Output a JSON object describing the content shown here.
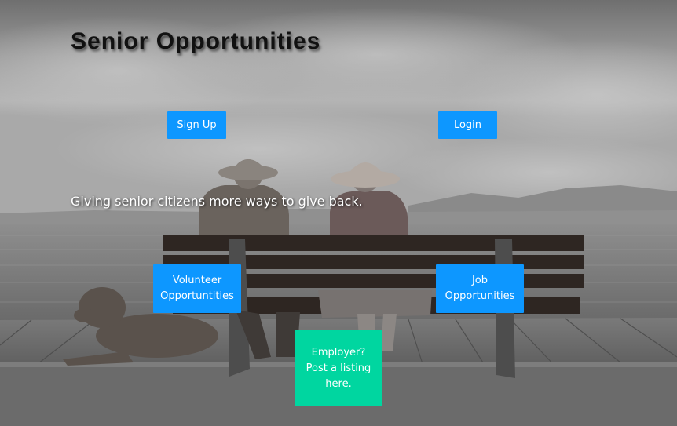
{
  "header": {
    "title": "Senior Opportunities"
  },
  "hero": {
    "tagline": "Giving senior citizens more ways to give back."
  },
  "auth": {
    "signup_label": "Sign Up",
    "login_label": "Login"
  },
  "actions": {
    "volunteer_label": "Volunteer Opportuntities",
    "job_label": "Job Opportunities",
    "employer_label": "Employer? Post a listing here."
  },
  "colors": {
    "primary_button": "#0d97ff",
    "employer_button": "#00d6a0",
    "button_text": "#ffffff",
    "title_text": "#111111"
  },
  "background": {
    "description_icon": "photo-seniors-on-bench-icon"
  }
}
